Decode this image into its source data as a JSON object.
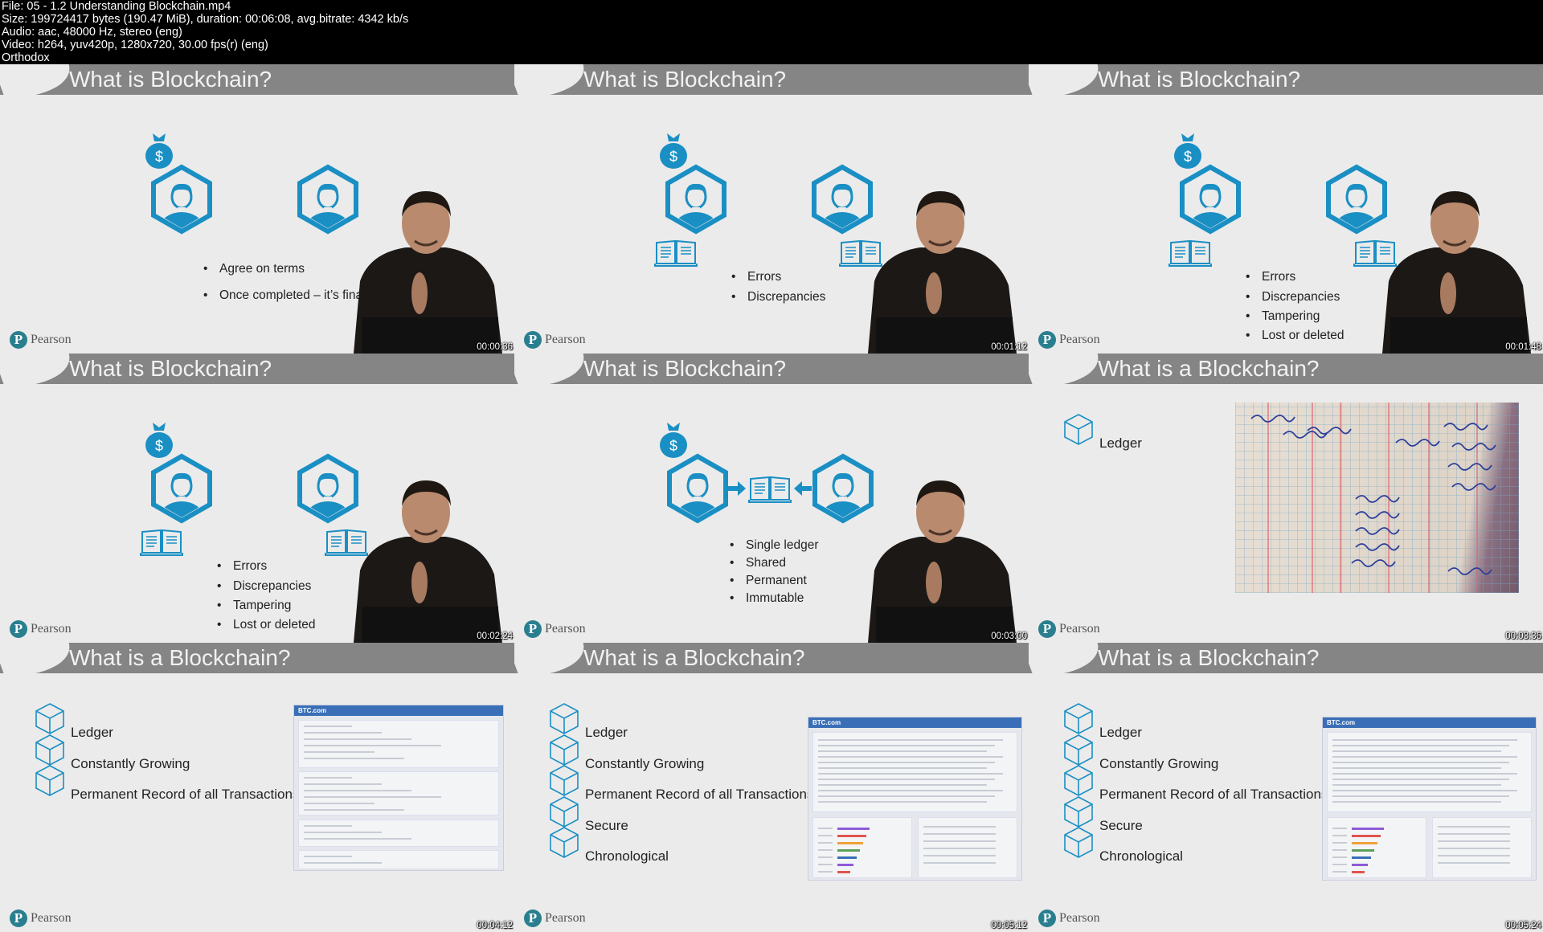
{
  "file_info": [
    "File: 05 - 1.2 Understanding Blockchain.mp4",
    "Size: 199724417 bytes (190.47 MiB), duration: 00:06:08, avg.bitrate: 4342 kb/s",
    "Audio: aac, 48000 Hz, stereo (eng)",
    "Video: h264, yuv420p, 1280x720, 30.00 fps(r) (eng)",
    "Orthodox"
  ],
  "brand": {
    "logo_text": "Pearson",
    "accent": "#1a8fc4",
    "logo_color": "#2a7f8f"
  },
  "thumbnails": [
    {
      "title": "What is Blockchain?",
      "timestamp": "00:00:36",
      "scene": "two-parties",
      "icons": [
        "money-bag-icon",
        "person-hex-icon",
        "person-hex-icon"
      ],
      "bullets": [
        "Agree on terms",
        "Once completed – it’s final"
      ],
      "presenter": true
    },
    {
      "title": "What is Blockchain?",
      "timestamp": "00:01:12",
      "scene": "two-ledgers",
      "icons": [
        "money-bag-icon",
        "person-hex-icon",
        "person-hex-icon",
        "book-icon",
        "book-icon"
      ],
      "bullets": [
        "Errors",
        "Discrepancies"
      ],
      "presenter": true
    },
    {
      "title": "What is Blockchain?",
      "timestamp": "00:01:48",
      "scene": "two-ledgers",
      "icons": [
        "money-bag-icon",
        "person-hex-icon",
        "person-hex-icon",
        "book-icon",
        "book-icon"
      ],
      "bullets": [
        "Errors",
        "Discrepancies",
        "Tampering",
        "Lost or deleted"
      ],
      "presenter": true
    },
    {
      "title": "What is Blockchain?",
      "timestamp": "00:02:24",
      "scene": "two-ledgers-below",
      "icons": [
        "money-bag-icon",
        "person-hex-icon",
        "person-hex-icon",
        "book-icon",
        "book-icon"
      ],
      "bullets": [
        "Errors",
        "Discrepancies",
        "Tampering",
        "Lost or deleted"
      ],
      "presenter": true
    },
    {
      "title": "What is Blockchain?",
      "timestamp": "00:03:00",
      "scene": "shared-ledger",
      "icons": [
        "money-bag-icon",
        "person-hex-icon",
        "arrow-right-icon",
        "book-icon",
        "arrow-left-icon",
        "person-hex-icon"
      ],
      "bullets": [
        "Single ledger",
        "Shared",
        "Permanent",
        "Immutable"
      ],
      "presenter": true
    },
    {
      "title": "What is a Blockchain?",
      "timestamp": "00:03:36",
      "scene": "ledger-photo",
      "icons": [
        "cube-icon"
      ],
      "labels": [
        "Ledger"
      ],
      "presenter": false
    },
    {
      "title": "What is a Blockchain?",
      "timestamp": "00:04:12",
      "scene": "btc-transaction",
      "icons": [
        "cube-icon"
      ],
      "labels": [
        "Ledger",
        "Constantly Growing",
        "Permanent Record of all Transactions"
      ],
      "site_logo": "BTC.com",
      "presenter": false
    },
    {
      "title": "What is a Blockchain?",
      "timestamp": "00:05:12",
      "scene": "btc-blocks",
      "icons": [
        "cube-icon"
      ],
      "labels": [
        "Ledger",
        "Constantly Growing",
        "Permanent Record of all Transactions",
        "Secure",
        "Chronological"
      ],
      "site_logo": "BTC.com",
      "presenter": false
    },
    {
      "title": "What is a Blockchain?",
      "timestamp": "00:05:24",
      "scene": "btc-blocks",
      "icons": [
        "cube-icon"
      ],
      "labels": [
        "Ledger",
        "Constantly Growing",
        "Permanent Record of all Transactions",
        "Secure",
        "Chronological"
      ],
      "site_logo": "BTC.com",
      "presenter": false
    }
  ]
}
